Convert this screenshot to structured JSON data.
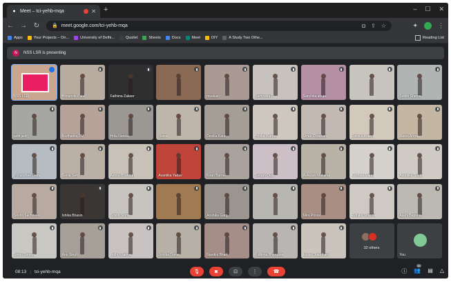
{
  "browser": {
    "tab_title": "Meet – tci-yehb-mqa",
    "url": "meet.google.com/tci-yehb-mqa",
    "bookmarks": [
      {
        "label": "Apps",
        "color": "#4285f4"
      },
      {
        "label": "Your Projects – On...",
        "color": "#fbbc04"
      },
      {
        "label": "University of Delhi...",
        "color": "#a142f4"
      },
      {
        "label": "Quizlet",
        "color": "#3c4043"
      },
      {
        "label": "Sheets",
        "color": "#34a853"
      },
      {
        "label": "Docs",
        "color": "#4285f4"
      },
      {
        "label": "Meet",
        "color": "#00897b"
      },
      {
        "label": "DIY",
        "color": "#fbbc04"
      },
      {
        "label": "A Study Two Othe...",
        "color": "#5f6368"
      }
    ],
    "reading_list": "Reading List"
  },
  "meet": {
    "presenting_avatar": "N",
    "presenting_text": "NSS LSR is presenting",
    "tiles": [
      {
        "name": "NSS LSR",
        "bg": "#c9a78f",
        "type": "presenting"
      },
      {
        "name": "Himanshi Patel",
        "bg": "#b8aca0"
      },
      {
        "name": "Fathima Zakeer",
        "bg": "#2f2f30"
      },
      {
        "name": "",
        "bg": "#8a6a55"
      },
      {
        "name": "muskan",
        "bg": "#a99a94"
      },
      {
        "name": "Samyukta P",
        "bg": "#c7c2bd"
      },
      {
        "name": "Sanchita ahuja",
        "bg": "#b58fa4"
      },
      {
        "name": "",
        "bg": "#c8c4be"
      },
      {
        "name": "Siddhi Shetye",
        "bg": "#b0b4b3"
      },
      {
        "name": "aditi jain",
        "bg": "#a6a7a3"
      },
      {
        "name": "Nodharika PM",
        "bg": "#b5a39a"
      },
      {
        "name": "Hrila Nanda",
        "bg": "#9b9792"
      },
      {
        "name": "Naina",
        "bg": "#bfb6ab"
      },
      {
        "name": "Devika Kaur",
        "bg": "#a49e96"
      },
      {
        "name": "Hrisha Warrier",
        "bg": "#cdc7bf"
      },
      {
        "name": "Vinati Chauhan",
        "bg": "#c2b9b3"
      },
      {
        "name": "Damika Anand",
        "bg": "#d2c8bc"
      },
      {
        "name": "Mansi Arora",
        "bg": "#c3b6a3"
      },
      {
        "name": "Priyanshee Dadu",
        "bg": "#b5bcc2"
      },
      {
        "name": "Sonia Sen",
        "bg": "#bbb0a6"
      },
      {
        "name": "Ashita Bhandari",
        "bg": "#c8c1b8"
      },
      {
        "name": "Avantika Yadav",
        "bg": "#c1443b"
      },
      {
        "name": "Kiran Barnal",
        "bg": "#aaa29c"
      },
      {
        "name": "Sonam Dias",
        "bg": "#cdbfc6"
      },
      {
        "name": "Ashwani Makaria",
        "bg": "#b9b2a6"
      },
      {
        "name": "Karthika Manoj",
        "bg": "#d5d2cd"
      },
      {
        "name": "Avantika Singh",
        "bg": "#cfcac4"
      },
      {
        "name": "Srishti Sachdeva",
        "bg": "#b8aaa0"
      },
      {
        "name": "Ishika Bhasin",
        "bg": "#3a3634"
      },
      {
        "name": "Srishti Sinha",
        "bg": "#c7c3bf"
      },
      {
        "name": "",
        "bg": "#a07a52"
      },
      {
        "name": "Anshika Garg",
        "bg": "#9b9590"
      },
      {
        "name": "",
        "bg": "#b8b6b1"
      },
      {
        "name": "Mira Prince",
        "bg": "#a98e83"
      },
      {
        "name": "Ridhika Sharma",
        "bg": "#cfc9c3"
      },
      {
        "name": "Aashi Bagaria",
        "bg": "#bcb8b2"
      },
      {
        "name": "Smriti Suneja",
        "bg": "#c9c7c1"
      },
      {
        "name": "Anu Singh",
        "bg": "#a7a099"
      },
      {
        "name": "Ridhi Khanna",
        "bg": "#c8c2c2"
      },
      {
        "name": "Jyotika Tomar",
        "bg": "#b6b0a6"
      },
      {
        "name": "Nandini Bhatt",
        "bg": "#a58e88"
      },
      {
        "name": "Ridhima Bhargava",
        "bg": "#b9b5b2"
      },
      {
        "name": "Ishita Chaudhary",
        "bg": "#cac4bd"
      },
      {
        "name": "32 others",
        "type": "others"
      },
      {
        "name": "You",
        "type": "you"
      }
    ],
    "others_avatar_colors": [
      "#8d6e63",
      "#d93025"
    ],
    "meeting_time": "08:13",
    "meeting_code": "tci-yehb-mqa",
    "controls": [
      {
        "name": "mic-off",
        "glyph": "🎙",
        "red": true
      },
      {
        "name": "camera-off",
        "glyph": "◙",
        "red": true
      },
      {
        "name": "present",
        "glyph": "⊡",
        "red": false
      },
      {
        "name": "more",
        "glyph": "⋮",
        "red": false
      }
    ],
    "end_call_glyph": "☎"
  }
}
